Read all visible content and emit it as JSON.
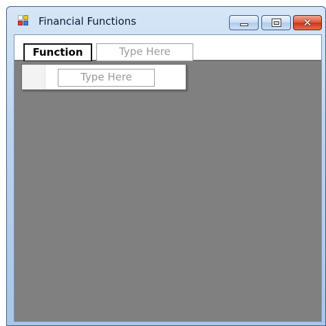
{
  "window": {
    "title": "Financial Functions",
    "icon": "app-window-icon",
    "controls": {
      "minimize": "minimize-icon",
      "maximize": "maximize-icon",
      "close_glyph": "✕"
    }
  },
  "menubar": {
    "items": [
      {
        "label": "Function"
      }
    ],
    "new_item_placeholder": "Type Here"
  },
  "dropdown": {
    "new_item_placeholder": "Type Here"
  },
  "colors": {
    "client_background": "#808080",
    "title_gradient_top": "#d6e6f7",
    "close_button": "#c8361b"
  }
}
